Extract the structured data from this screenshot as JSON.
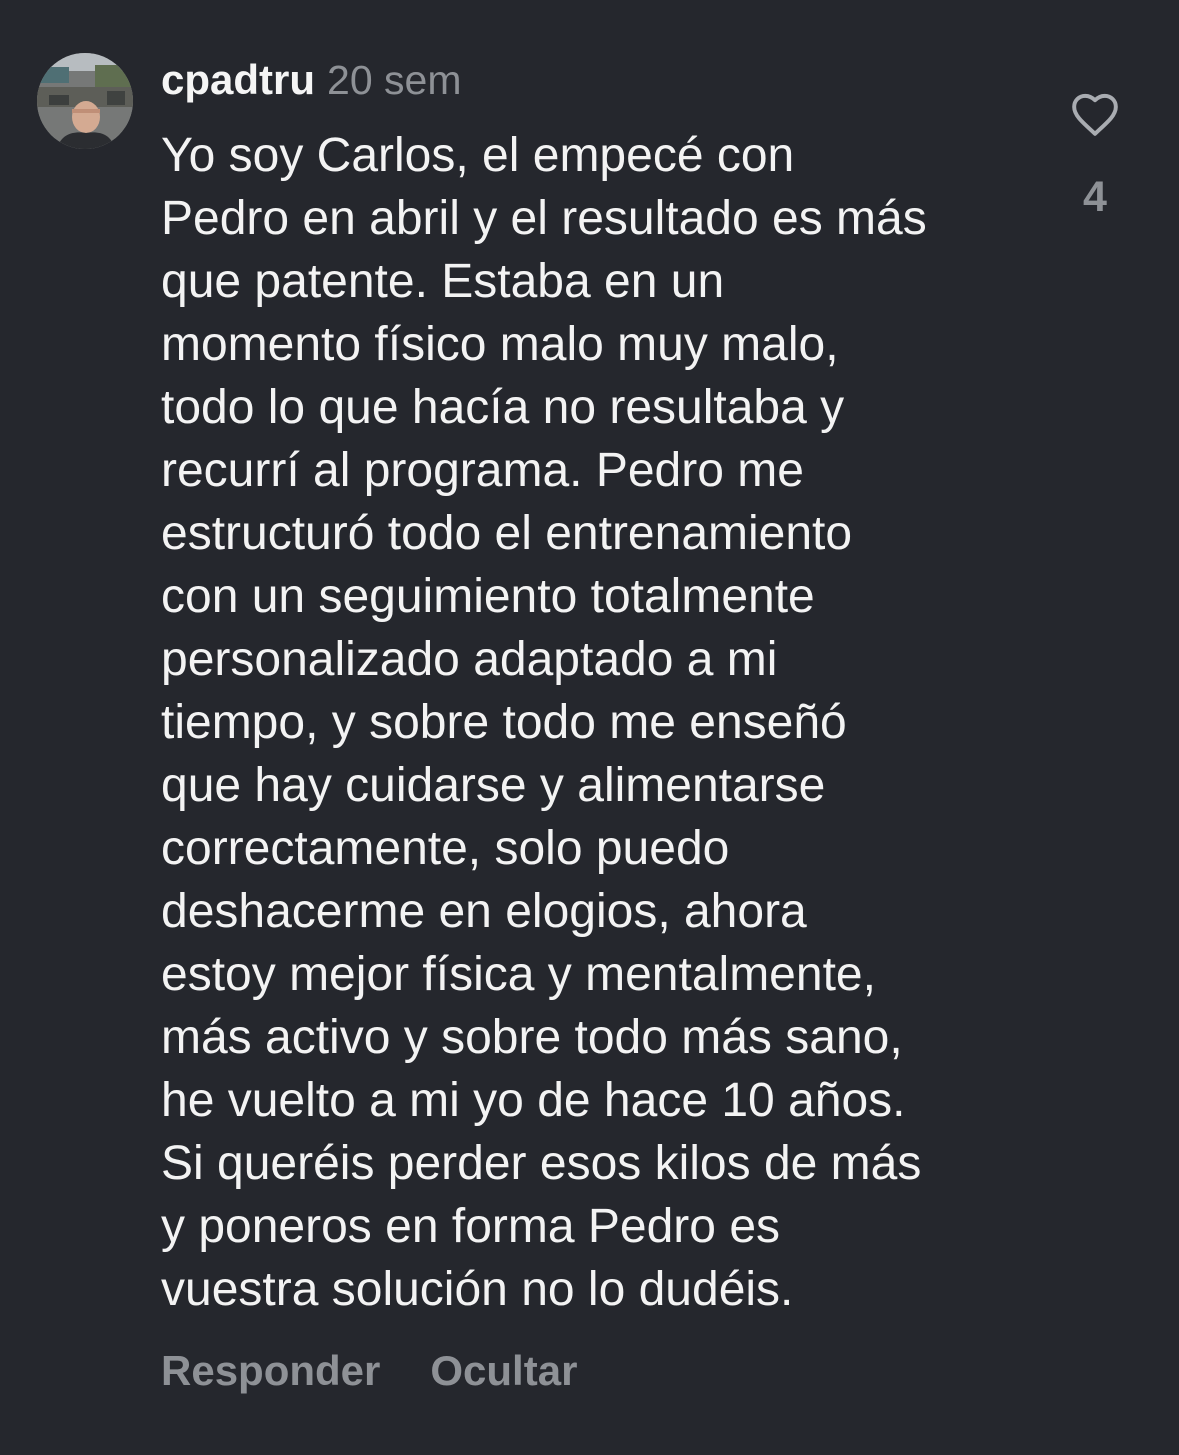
{
  "comment": {
    "username": "cpadtru",
    "time": "20 sem",
    "avatar_icon": "user-avatar-photo",
    "lines": [
      "Yo soy Carlos, el empecé con",
      "Pedro en abril y el resultado es más",
      "que patente. Estaba en un",
      "momento físico malo muy malo,",
      "todo lo que hacía no resultaba y",
      "recurrí al programa. Pedro me",
      "estructuró todo el entrenamiento",
      "con un seguimiento totalmente",
      "personalizado adaptado a mi",
      "tiempo, y sobre todo me enseñó",
      "que hay cuidarse y alimentarse",
      "correctamente, solo puedo",
      "deshacerme en elogios, ahora",
      "estoy mejor física y mentalmente,",
      "más activo y sobre todo más sano,",
      "he vuelto a mi yo de hace 10 años.",
      "Si queréis perder esos kilos de más",
      "y poneros en forma Pedro es",
      "vuestra solución no lo dudéis."
    ],
    "like": {
      "icon": "heart-outline-icon",
      "count": "4"
    },
    "actions": {
      "reply": "Responder",
      "hide": "Ocultar"
    }
  },
  "colors": {
    "background": "#25272d",
    "text_primary": "#f3f3f3",
    "text_secondary": "#8e9196"
  }
}
